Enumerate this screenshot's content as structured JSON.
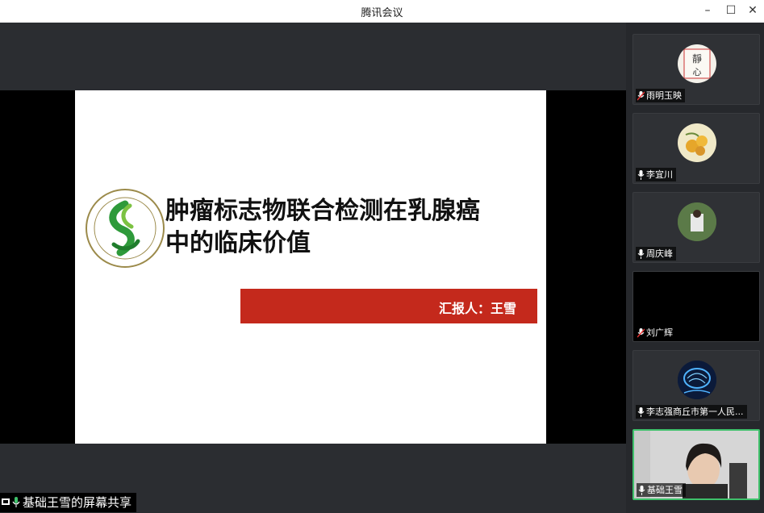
{
  "window": {
    "title": "腾讯会议",
    "minimize": "–",
    "maximize": "☐",
    "close": "✕"
  },
  "slide": {
    "title_line1": "肿瘤标志物联合检测在乳腺癌",
    "title_line2": "中的临床价值",
    "presenter": "汇报人：王雪",
    "logo_text": "SHANGQIU MEDICAL COLLEGE",
    "accent_color": "#c4291c"
  },
  "share_label": "基础王雪的屏幕共享",
  "participants": [
    {
      "name": "雨明玉映",
      "muted": true
    },
    {
      "name": "李宜川",
      "muted": false
    },
    {
      "name": "周庆峰",
      "muted": false
    },
    {
      "name": "刘广辉",
      "muted": true
    },
    {
      "name": "李志强商丘市第一人民...",
      "muted": false
    },
    {
      "name": "基础王雪",
      "muted": false,
      "active": true
    }
  ],
  "colors": {
    "active_border": "#3fc16b",
    "background": "#2b2d31"
  }
}
